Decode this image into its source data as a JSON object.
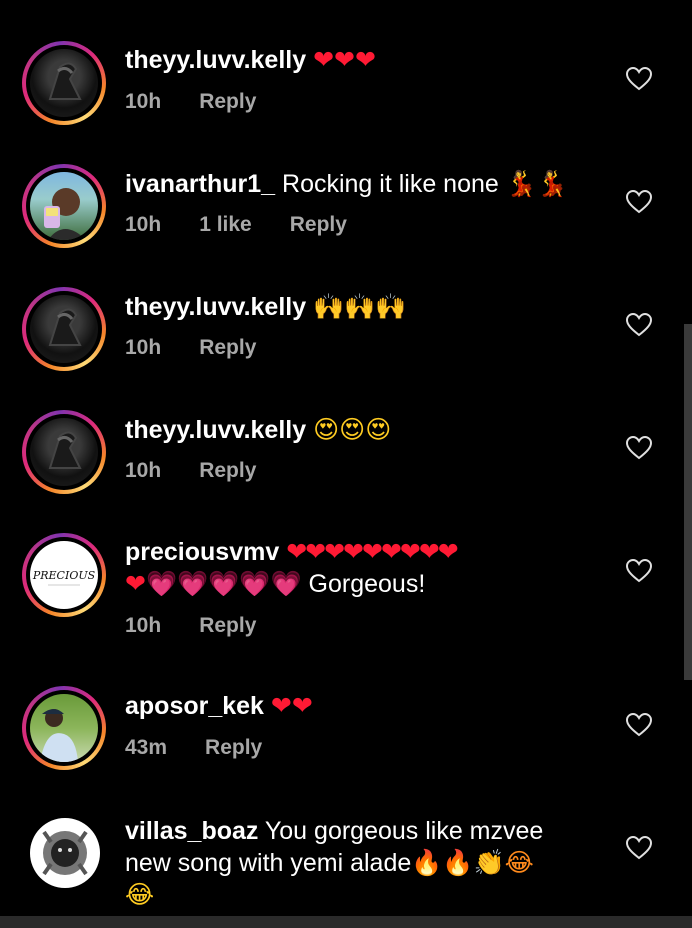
{
  "comments": [
    {
      "username": "theyy.luvv.kelly",
      "text": "",
      "emoji": "❤❤❤",
      "emoji_color": "#ff1a34",
      "time": "10h",
      "likes": "",
      "reply": "Reply",
      "avatar": "dark-portrait"
    },
    {
      "username": "ivanarthur1_",
      "text": " Rocking it like none ",
      "emoji": "💃💃",
      "emoji_color": "#ff3b30",
      "time": "10h",
      "likes": "1 like",
      "reply": "Reply",
      "avatar": "selfie-portrait"
    },
    {
      "username": "theyy.luvv.kelly",
      "text": "",
      "emoji": "🙌🙌🙌",
      "emoji_color": "#ffcc22",
      "time": "10h",
      "likes": "",
      "reply": "Reply",
      "avatar": "dark-portrait"
    },
    {
      "username": "theyy.luvv.kelly",
      "text": "",
      "emoji": "😍😍😍",
      "emoji_color": "#ffcc22",
      "time": "10h",
      "likes": "",
      "reply": "Reply",
      "avatar": "dark-portrait"
    },
    {
      "username": "preciousvmv",
      "text": "Gorgeous!",
      "emoji_line1": "❤❤❤❤❤❤❤❤❤",
      "emoji_line2_red": "❤",
      "emoji_line2_pink": "💗💗💗💗💗",
      "time": "10h",
      "likes": "",
      "reply": "Reply",
      "avatar": "precious-logo",
      "avatar_text": "PRECIOUS"
    },
    {
      "username": "aposor_kek",
      "text": "",
      "emoji": "❤❤",
      "emoji_color": "#ff1a34",
      "time": "43m",
      "likes": "",
      "reply": "Reply",
      "avatar": "outdoor-portrait"
    },
    {
      "username": "villas_boaz",
      "text_line1": " You gorgeous like mzvee",
      "text_line2": "new song with yemi alade",
      "emoji_line2": "🔥🔥👏😂",
      "emoji_line3": "😂",
      "avatar": "lion-emblem"
    }
  ]
}
